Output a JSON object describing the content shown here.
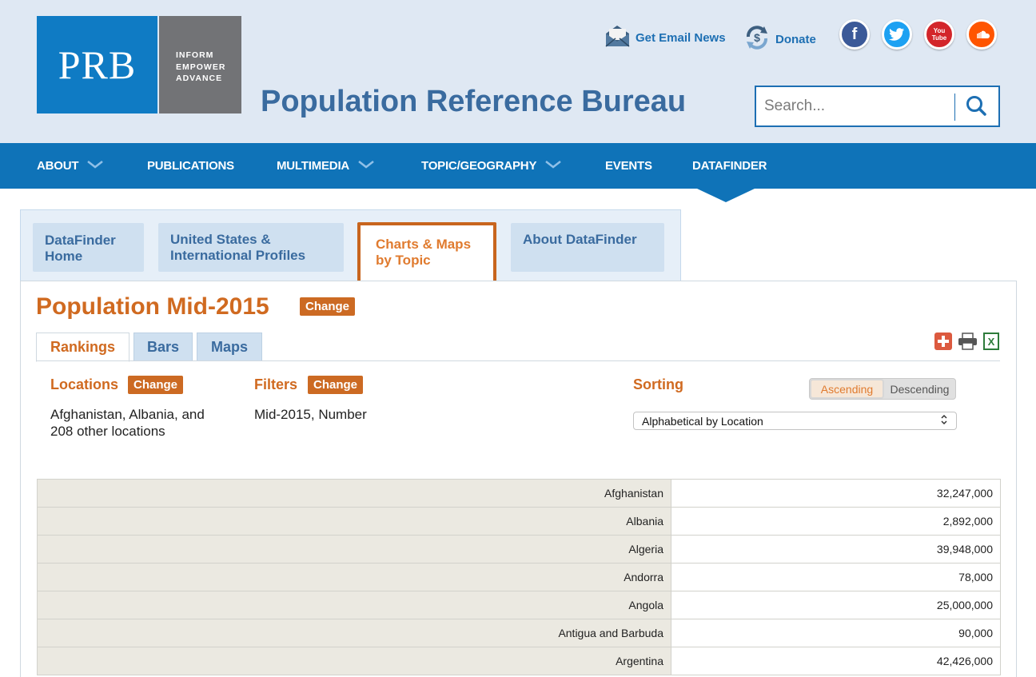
{
  "header": {
    "logo_text": "PRB",
    "tagline": [
      "INFORM",
      "EMPOWER",
      "ADVANCE"
    ],
    "site_title": "Population Reference Bureau",
    "email_news_label": "Get Email News",
    "donate_label": "Donate",
    "social": [
      {
        "name": "facebook",
        "color": "#3b5998",
        "glyph": "f"
      },
      {
        "name": "twitter",
        "color": "#1da1f2",
        "glyph": "t"
      },
      {
        "name": "youtube",
        "color": "#d3262a",
        "glyph": "You Tube"
      },
      {
        "name": "soundcloud",
        "color": "#ff5500",
        "glyph": "cloud"
      }
    ],
    "search_placeholder": "Search..."
  },
  "nav": {
    "items": [
      {
        "label": "ABOUT",
        "has_dropdown": true
      },
      {
        "label": "PUBLICATIONS",
        "has_dropdown": false
      },
      {
        "label": "MULTIMEDIA",
        "has_dropdown": true
      },
      {
        "label": "TOPIC/GEOGRAPHY",
        "has_dropdown": true
      },
      {
        "label": "EVENTS",
        "has_dropdown": false
      },
      {
        "label": "DATAFINDER",
        "has_dropdown": false,
        "active": true
      }
    ]
  },
  "datafinder_tabs": [
    {
      "label_line1": "DataFinder",
      "label_line2": "Home"
    },
    {
      "label_line1": "United States &",
      "label_line2": "International Profiles"
    },
    {
      "label_line1": "Charts & Maps",
      "label_line2": "by Topic",
      "active": true
    },
    {
      "label_line1": "About DataFinder",
      "label_line2": ""
    }
  ],
  "main": {
    "title": "Population Mid-2015",
    "change_label": "Change",
    "view_tabs": [
      "Rankings",
      "Bars",
      "Maps"
    ],
    "active_view": "Rankings",
    "locations": {
      "label": "Locations",
      "line1": "Afghanistan, Albania, and",
      "line2": "208 other locations"
    },
    "filters": {
      "label": "Filters",
      "text": "Mid-2015, Number"
    },
    "sorting": {
      "label": "Sorting",
      "ascending_label": "Ascending",
      "descending_label": "Descending",
      "selected": "Alphabetical by Location"
    }
  },
  "table": {
    "rows": [
      {
        "location": "Afghanistan",
        "value": "32,247,000"
      },
      {
        "location": "Albania",
        "value": "2,892,000"
      },
      {
        "location": "Algeria",
        "value": "39,948,000"
      },
      {
        "location": "Andorra",
        "value": "78,000"
      },
      {
        "location": "Angola",
        "value": "25,000,000"
      },
      {
        "location": "Antigua and Barbuda",
        "value": "90,000"
      },
      {
        "location": "Argentina",
        "value": "42,426,000"
      }
    ]
  },
  "colors": {
    "brand_blue": "#0f73b8",
    "title_blue": "#3a6b9f",
    "accent_orange": "#cc6a23"
  }
}
